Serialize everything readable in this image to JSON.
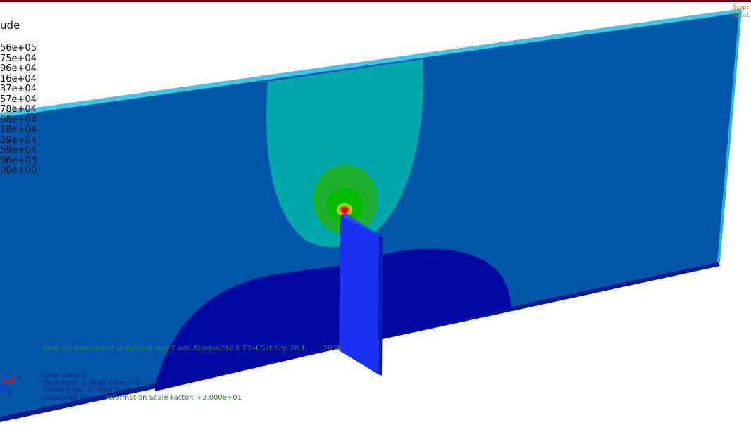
{
  "header": {
    "step_label": "Step:",
    "step_value": "Total"
  },
  "legend": {
    "title": "ude",
    "values": [
      "56e+05",
      "75e+04",
      "96e+04",
      "16e+04",
      "37e+04",
      "57e+04",
      "78e+04",
      "98e+04",
      "18e+04",
      "39e+04",
      "59e+04",
      "96e+03",
      "00e+00"
    ]
  },
  "info": {
    "odb": "ODB: Co-execution-FSI-Remesh-wgt-2.odb    Abaqus/Std 6.13-4    Sat Sep 28 1... ... 2018",
    "step": "Step: Step-1",
    "increment": "Increment      1: Step Time =          0",
    "primary_var": "Primary Var: V, Magnitude",
    "deformed_var_prefix": "Deformed Var: U",
    "deformation_scale": "Deformation Scale Factor: +2.000e+01"
  },
  "triad": {
    "x_label": "X",
    "z_label": "Z"
  },
  "colors": {
    "plate": "#0156aa",
    "plate_top_edge": "#39c9f0",
    "wake_low": "#00095d",
    "wake": "#0008a0",
    "contour_cyan": "#00a8ac",
    "contour_green": "#1cb32c",
    "contour_green2": "#00b800",
    "hotspot_red": "#d11212",
    "fin": "#1a32f0"
  }
}
